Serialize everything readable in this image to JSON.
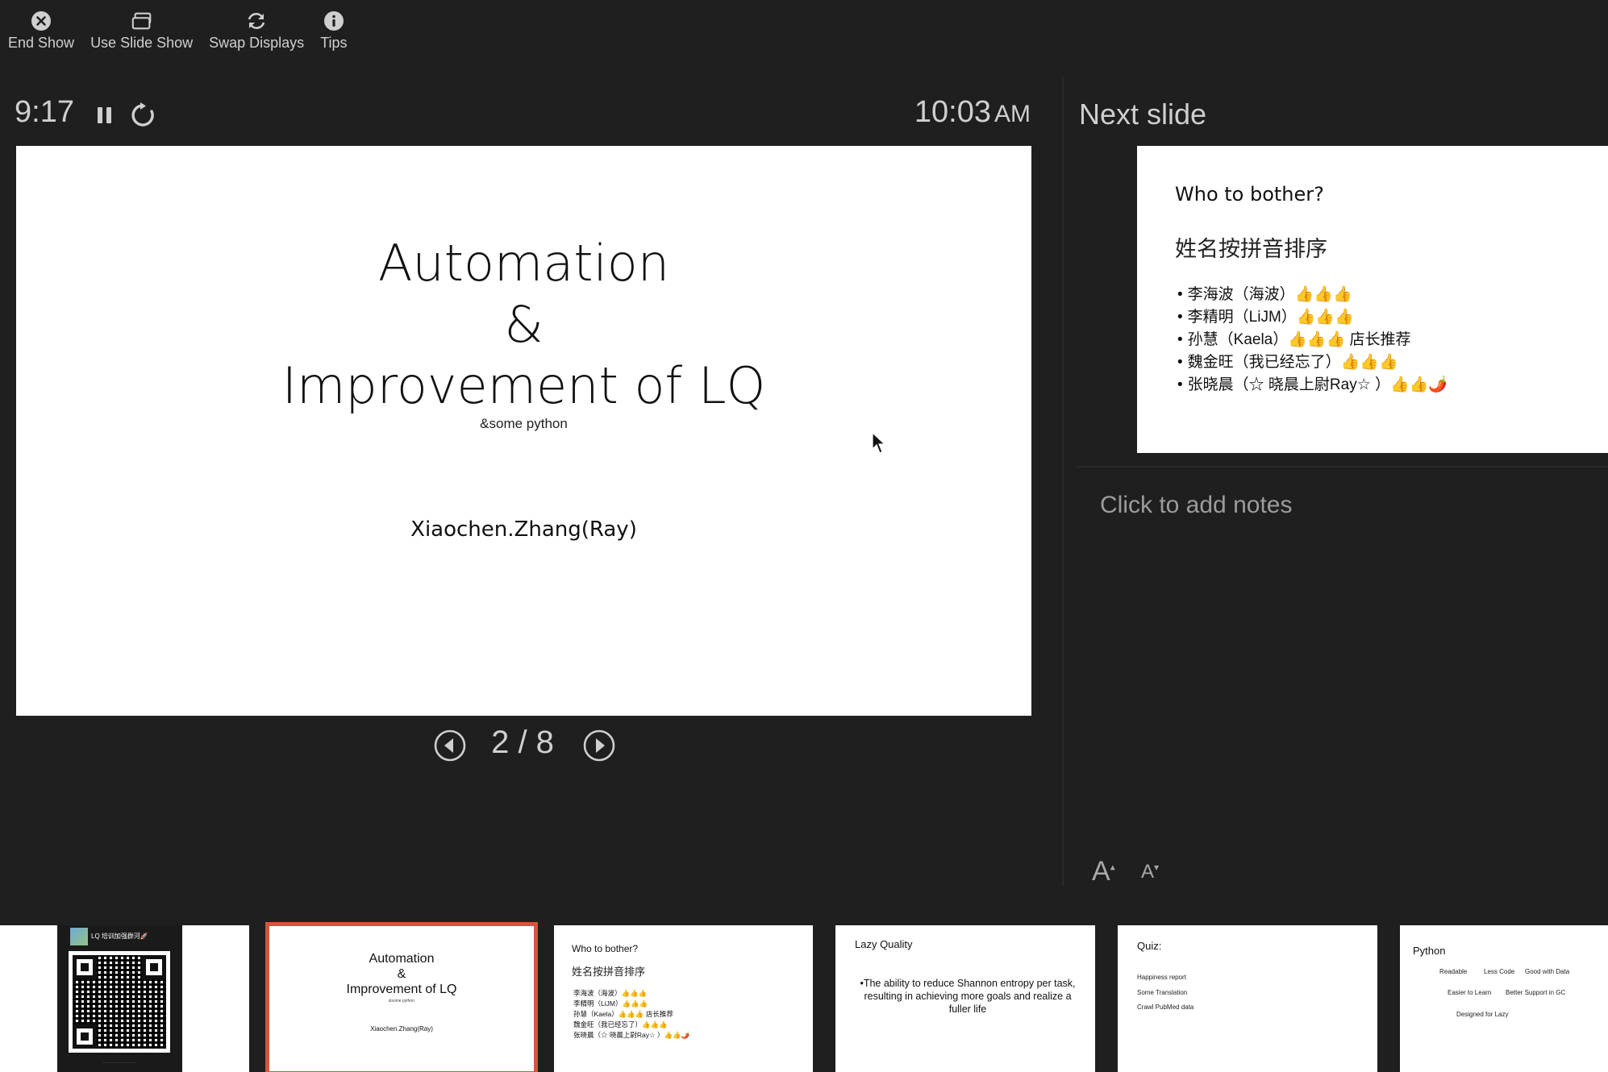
{
  "toolbar": {
    "end_show": {
      "label": "End Show",
      "icon": "close-circle-icon"
    },
    "use_slide_show": {
      "label": "Use Slide Show",
      "icon": "window-stack-icon"
    },
    "swap_displays": {
      "label": "Swap Displays",
      "icon": "swap-icon"
    },
    "tips": {
      "label": "Tips",
      "icon": "info-icon"
    }
  },
  "timer": {
    "elapsed": "9:17",
    "clock_time": "10:03",
    "clock_ampm": "AM"
  },
  "current_slide": {
    "title_line1": "Automation",
    "title_line2": "&",
    "title_line3": "Improvement of LQ",
    "subtitle": "&some python",
    "author": "Xiaochen.Zhang(Ray)"
  },
  "navigation": {
    "counter": "2 / 8"
  },
  "next_slide": {
    "label": "Next slide",
    "title": "Who to bother?",
    "subtitle": "姓名按拼音排序",
    "items": [
      "李海波（海波）👍👍👍",
      "李精明（LiJM）👍👍👍",
      "孙慧（Kaela）👍👍👍 店长推荐",
      "魏金旺（我已经忘了）👍👍👍",
      "张晓晨（☆ 晓晨上尉Ray☆ ）👍👍🌶️"
    ]
  },
  "notes": {
    "placeholder": "Click to add notes"
  },
  "font_controls": {
    "increase": "A",
    "decrease": "A"
  },
  "thumbnails": {
    "t1": {
      "caption": "LQ 培训加强群河🚀",
      "footer": "·····················"
    },
    "t2": {
      "line1": "Automation",
      "line2": "&",
      "line3": "Improvement of LQ",
      "sub": "&some python",
      "author": "Xiaochen.Zhang(Ray)"
    },
    "t3": {
      "title": "Who to bother?",
      "sub": "姓名按拼音排序",
      "items": [
        "李海波（海波）👍👍👍",
        "李精明（LiJM）👍👍👍",
        "孙慧（Kaela）👍👍👍 店长推荐",
        "魏金旺（我已经忘了）👍👍👍",
        "张晓晨（☆ 晓晨上尉Ray☆ ）👍👍🌶️"
      ]
    },
    "t4": {
      "title": "Lazy Quality",
      "body": "•The ability to reduce Shannon entropy per task, resulting in achieving more goals and realize a fuller life"
    },
    "t5": {
      "title": "Quiz:",
      "items": [
        "Happiness report",
        "Some Translation",
        "Crawl PubMed data"
      ]
    },
    "t6": {
      "title": "Python",
      "tags": [
        "Readable",
        "Less Code",
        "Good with Data",
        "Easier to Learn",
        "Better Support in GC",
        "Designed for Lazy"
      ]
    }
  }
}
